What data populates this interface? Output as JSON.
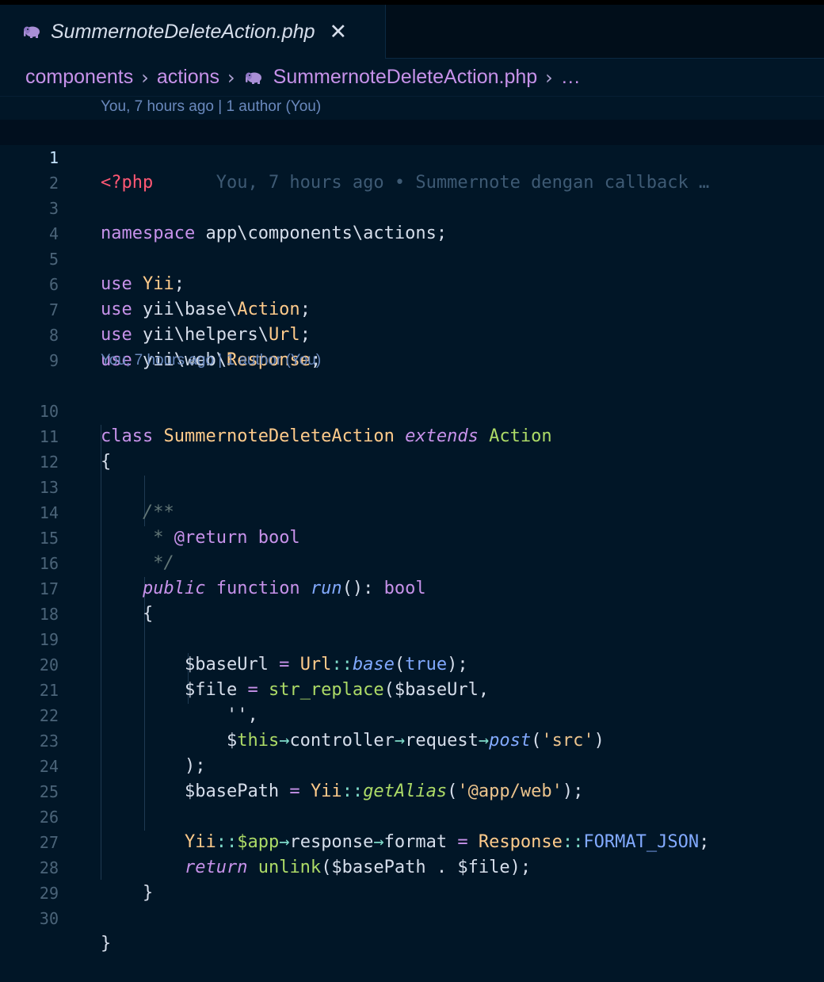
{
  "tab": {
    "title": "SummernoteDeleteAction.php",
    "icon": "php-elephant-icon",
    "close": "✕"
  },
  "breadcrumb": {
    "items": [
      "components",
      "actions",
      "SummernoteDeleteAction.php",
      "…"
    ],
    "separator": "›"
  },
  "editor": {
    "lens_1": "You, 7 hours ago | 1 author (You)",
    "lens_2": "You, 7 hours ago | 1 author (You)",
    "blame_1": "You, 7 hours ago • Summernote dengan callback …",
    "line_numbers": [
      "1",
      "2",
      "3",
      "4",
      "5",
      "6",
      "7",
      "8",
      "9",
      "10",
      "11",
      "12",
      "13",
      "14",
      "15",
      "16",
      "17",
      "18",
      "19",
      "20",
      "21",
      "22",
      "23",
      "24",
      "25",
      "26",
      "27",
      "28",
      "29",
      "30"
    ]
  },
  "code": {
    "l1": "<?php",
    "l3": [
      "namespace",
      " app\\components\\actions;"
    ],
    "l5": [
      "use",
      " ",
      "Yii",
      ";"
    ],
    "l6": [
      "use",
      " yii\\base\\",
      "Action",
      ";"
    ],
    "l7": [
      "use",
      " yii\\helpers\\",
      "Url",
      ";"
    ],
    "l8": [
      "use",
      " yii\\web\\",
      "Response",
      ";"
    ],
    "l10": [
      "class",
      " ",
      "SummernoteDeleteAction",
      " ",
      "extends",
      " ",
      "Action"
    ],
    "l11": "{",
    "l13": "/**",
    "l14": [
      "* ",
      "@return",
      " bool"
    ],
    "l15": "*/",
    "l16": [
      "public",
      " ",
      "function",
      " ",
      "run",
      "(): ",
      "bool"
    ],
    "l17": "{",
    "l19": [
      "$baseUrl",
      " = ",
      "Url",
      "::",
      "base",
      "(",
      "true",
      ");"
    ],
    "l20": [
      "$file",
      " = ",
      "str_replace",
      "($baseUrl,"
    ],
    "l21": "'',",
    "l22": [
      "$",
      "this",
      "→",
      "controller",
      "→",
      "request",
      "→",
      "post",
      "(",
      "'src'",
      ")"
    ],
    "l23": ");",
    "l24": [
      "$basePath",
      " = ",
      "Yii",
      "::",
      "getAlias",
      "(",
      "'@app/web'",
      ");"
    ],
    "l26": [
      "Yii",
      "::",
      "$app",
      "→",
      "response",
      "→",
      "format",
      " = ",
      "Response",
      "::",
      "FORMAT_JSON",
      ";"
    ],
    "l27": [
      "return",
      " ",
      "unlink",
      "($basePath . $file);"
    ],
    "l28": "}",
    "l30": "}"
  },
  "colors": {
    "background": "#011627",
    "keyword": "#c792ea",
    "class": "#ffcb8b",
    "function": "#82aaff",
    "string": "#ecc48d",
    "operator": "#7fdbca",
    "php_tag": "#ff5874"
  }
}
